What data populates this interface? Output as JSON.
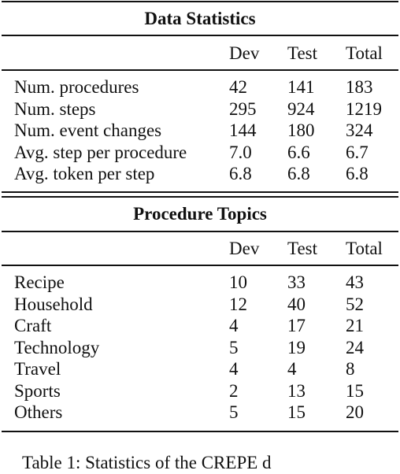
{
  "table": {
    "sections": [
      {
        "title": "Data Statistics",
        "columns": [
          "",
          "Dev",
          "Test",
          "Total"
        ],
        "rows": [
          {
            "label": "Num. procedures",
            "dev": "42",
            "test": "141",
            "total": "183"
          },
          {
            "label": "Num. steps",
            "dev": "295",
            "test": "924",
            "total": "1219"
          },
          {
            "label": "Num. event changes",
            "dev": "144",
            "test": "180",
            "total": "324"
          },
          {
            "label": "Avg. step per procedure",
            "dev": "7.0",
            "test": "6.6",
            "total": "6.7"
          },
          {
            "label": "Avg. token per step",
            "dev": "6.8",
            "test": "6.8",
            "total": "6.8"
          }
        ]
      },
      {
        "title": "Procedure Topics",
        "columns": [
          "",
          "Dev",
          "Test",
          "Total"
        ],
        "rows": [
          {
            "label": "Recipe",
            "dev": "10",
            "test": "33",
            "total": "43"
          },
          {
            "label": "Household",
            "dev": "12",
            "test": "40",
            "total": "52"
          },
          {
            "label": "Craft",
            "dev": "4",
            "test": "17",
            "total": "21"
          },
          {
            "label": "Technology",
            "dev": "5",
            "test": "19",
            "total": "24"
          },
          {
            "label": "Travel",
            "dev": "4",
            "test": "4",
            "total": "8"
          },
          {
            "label": "Sports",
            "dev": "2",
            "test": "13",
            "total": "15"
          },
          {
            "label": "Others",
            "dev": "5",
            "test": "15",
            "total": "20"
          }
        ]
      }
    ],
    "caption": "Table 1: Statistics of the CREPE d"
  }
}
